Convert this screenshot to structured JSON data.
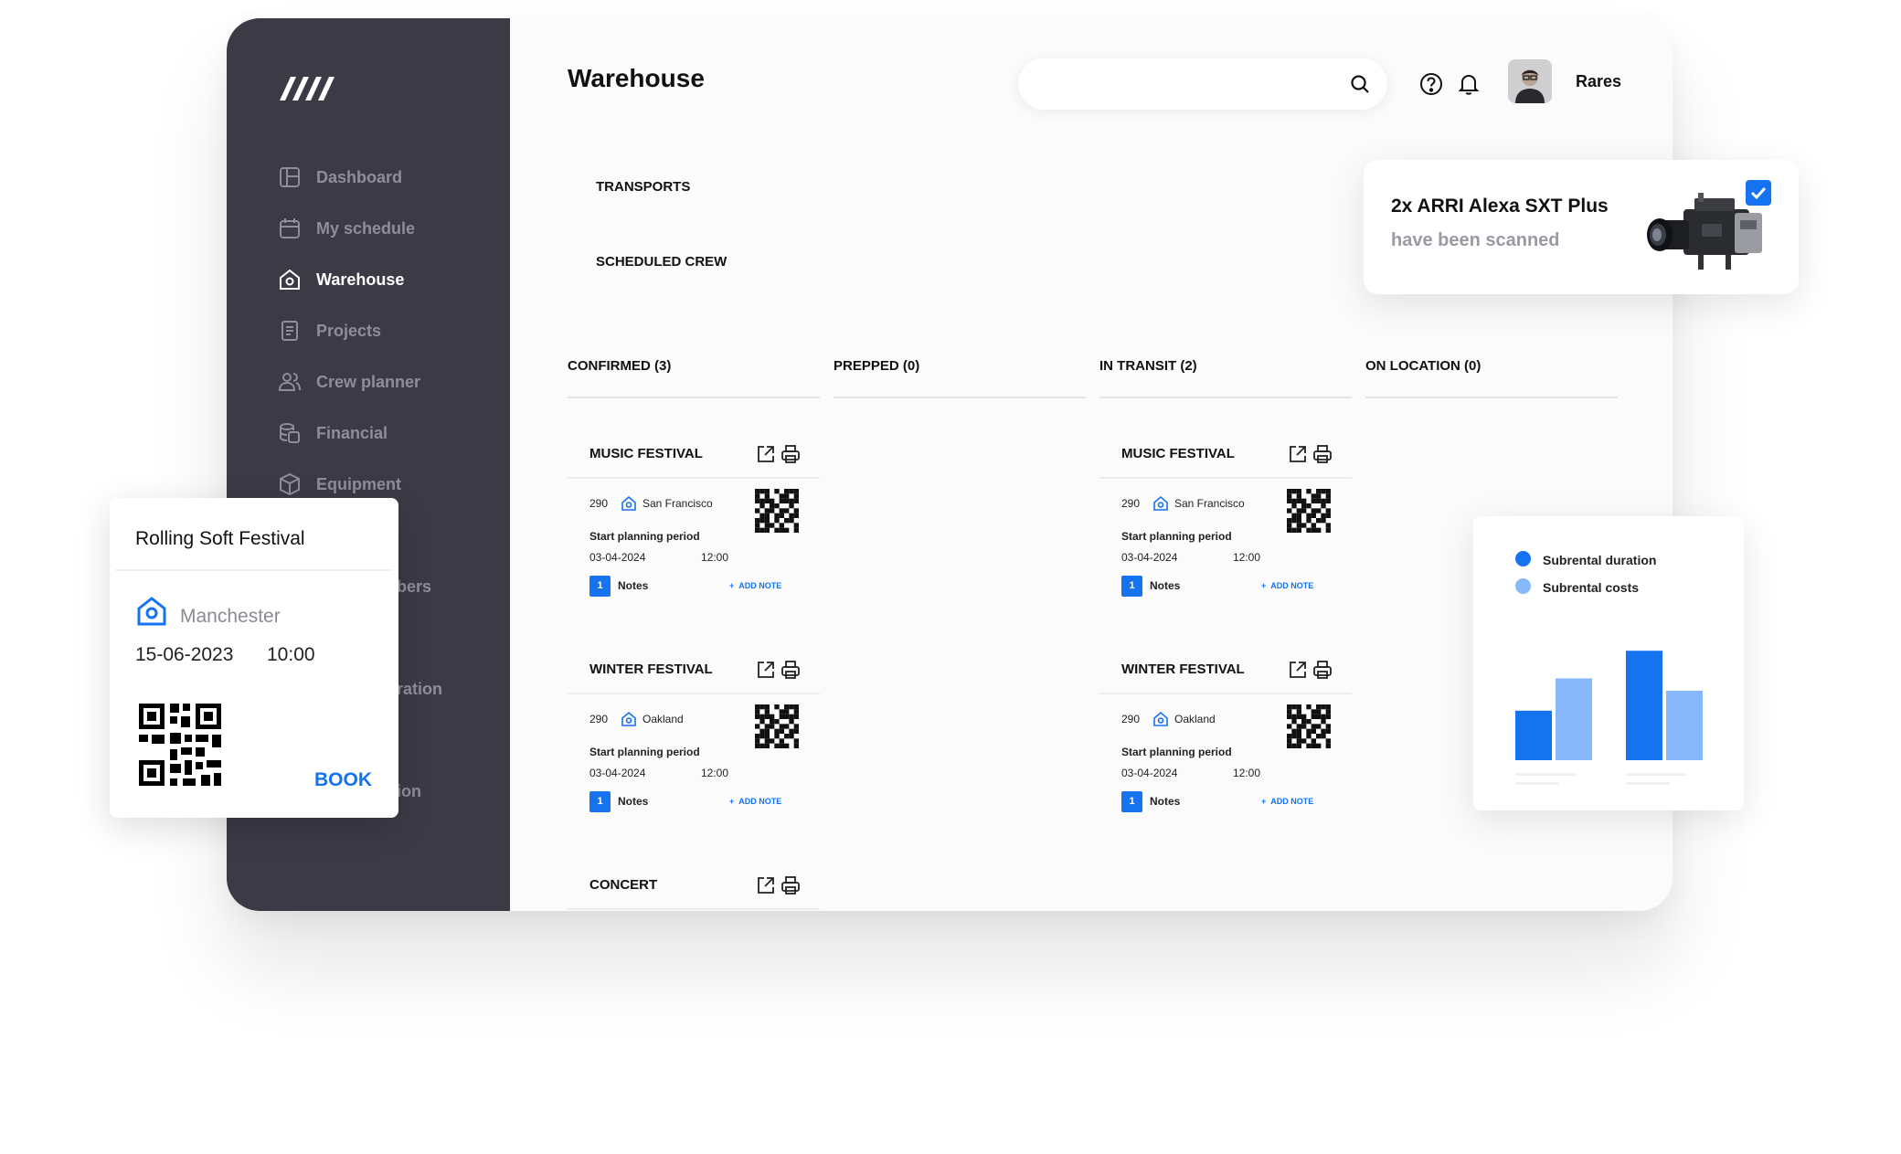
{
  "sidebar": {
    "items": [
      {
        "label": "Dashboard",
        "icon": "dashboard-icon"
      },
      {
        "label": "My schedule",
        "icon": "calendar-icon"
      },
      {
        "label": "Warehouse",
        "icon": "warehouse-icon",
        "active": true
      },
      {
        "label": "Projects",
        "icon": "document-icon"
      },
      {
        "label": "Crew planner",
        "icon": "people-icon"
      },
      {
        "label": "Financial",
        "icon": "coins-icon"
      },
      {
        "label": "Equipment",
        "icon": "box-icon"
      }
    ],
    "partial_labels": [
      "bers",
      "ration",
      "ion"
    ]
  },
  "header": {
    "title": "Warehouse",
    "search_placeholder": "",
    "user_name": "Rares"
  },
  "sections": {
    "transports": "TRANSPORTS",
    "scheduled_crew": "SCHEDULED CREW"
  },
  "columns": [
    {
      "title": "CONFIRMED (3)"
    },
    {
      "title": "PREPPED (0)"
    },
    {
      "title": "IN TRANSIT (2)"
    },
    {
      "title": "ON LOCATION (0)"
    }
  ],
  "cards": [
    {
      "column": 0,
      "title": "MUSIC FESTIVAL",
      "code": "290",
      "city": "San Francisco",
      "period_label": "Start planning period",
      "date": "03-04-2024",
      "time": "12:00",
      "notes_count": "1",
      "notes_label": "Notes",
      "add_note": "ADD NOTE"
    },
    {
      "column": 0,
      "title": "WINTER FESTIVAL",
      "code": "290",
      "city": "Oakland",
      "period_label": "Start planning period",
      "date": "03-04-2024",
      "time": "12:00",
      "notes_count": "1",
      "notes_label": "Notes",
      "add_note": "ADD NOTE"
    },
    {
      "column": 0,
      "title": "CONCERT"
    },
    {
      "column": 2,
      "title": "MUSIC FESTIVAL",
      "code": "290",
      "city": "San Francisco",
      "period_label": "Start planning period",
      "date": "03-04-2024",
      "time": "12:00",
      "notes_count": "1",
      "notes_label": "Notes",
      "add_note": "ADD NOTE"
    },
    {
      "column": 2,
      "title": "WINTER FESTIVAL",
      "code": "290",
      "city": "Oakland",
      "period_label": "Start planning period",
      "date": "03-04-2024",
      "time": "12:00",
      "notes_count": "1",
      "notes_label": "Notes",
      "add_note": "ADD NOTE"
    }
  ],
  "booking": {
    "title": "Rolling Soft Festival",
    "city": "Manchester",
    "date": "15-06-2023",
    "time": "10:00",
    "button": "BOOK"
  },
  "scan_notification": {
    "title": "2x ARRI Alexa SXT Plus",
    "subtitle": "have been scanned",
    "checked": true
  },
  "chart_data": {
    "type": "bar",
    "series": [
      {
        "name": "Subrental duration",
        "color": "#1573f0",
        "values": [
          52,
          115
        ]
      },
      {
        "name": "Subrental costs",
        "color": "#87b8fb",
        "values": [
          86,
          73
        ]
      }
    ],
    "categories": [
      "",
      ""
    ]
  },
  "colors": {
    "accent": "#1573f0",
    "accent_light": "#87b8fb",
    "sidebar": "#3b3a45"
  }
}
